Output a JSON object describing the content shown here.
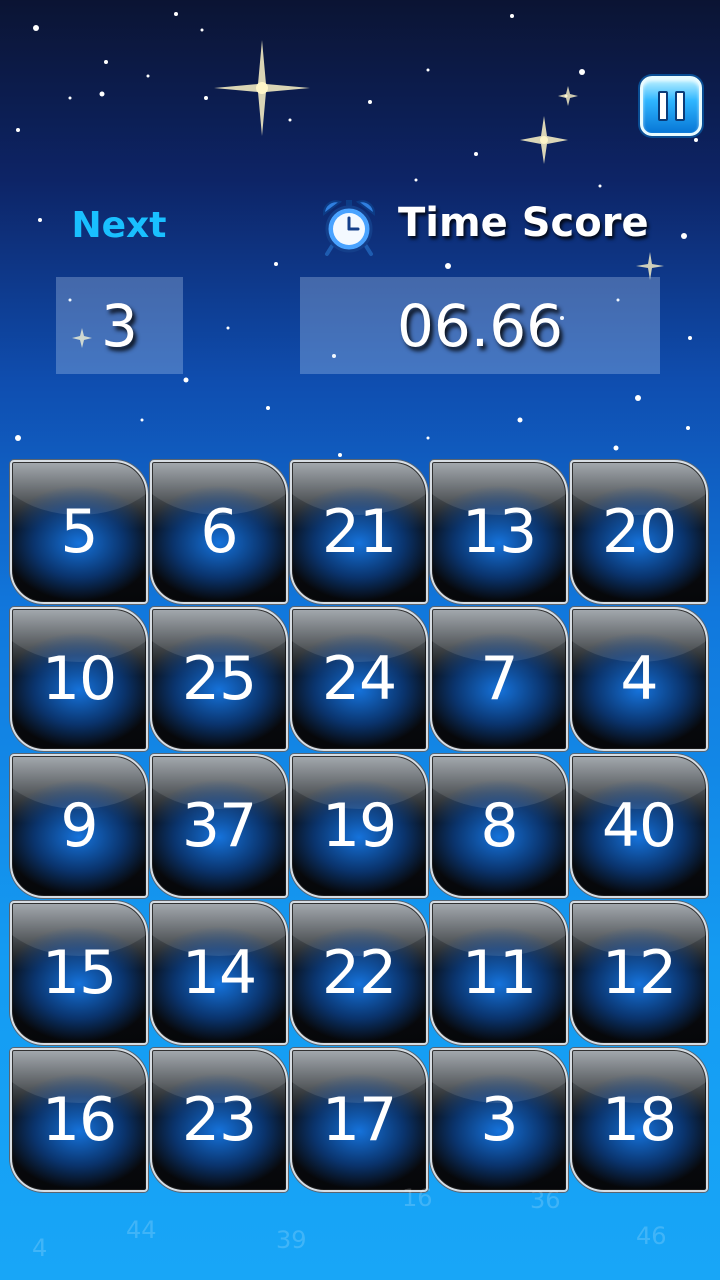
{
  "hud": {
    "next_label": "Next",
    "next_value": "3",
    "time_label": "Time Score",
    "time_value": "06.66"
  },
  "icons": {
    "pause": "pause-icon",
    "clock": "alarm-clock-icon"
  },
  "colors": {
    "next_label": "#19c0ff",
    "pause_button": "#2fb6ff",
    "tile_glow": "#1678e6"
  },
  "board": {
    "tiles": [
      "5",
      "6",
      "21",
      "13",
      "20",
      "10",
      "25",
      "24",
      "7",
      "4",
      "9",
      "37",
      "19",
      "8",
      "40",
      "15",
      "14",
      "22",
      "11",
      "12",
      "16",
      "23",
      "17",
      "3",
      "18"
    ]
  },
  "ghost_numbers": [
    "16",
    "36",
    "44",
    "4",
    "39",
    "46"
  ]
}
